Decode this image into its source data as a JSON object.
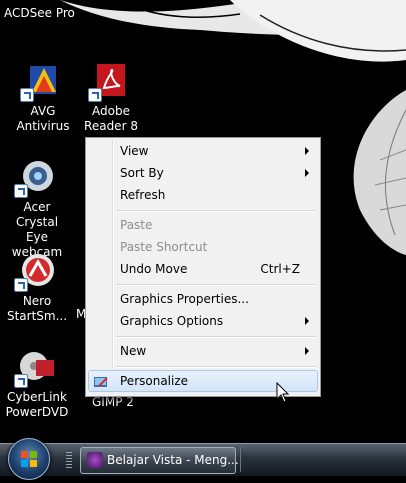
{
  "desktop": {
    "topline": "ACDSee Pro",
    "fragments": {
      "m_letter": "M",
      "gimp": "GIMP 2"
    },
    "icons": [
      {
        "label": "AVG\nAntivirus",
        "icon": "avg-icon"
      },
      {
        "label": "Adobe\nReader 8",
        "icon": "adobe-reader-icon"
      },
      {
        "label": "Acer Crystal\nEye webcam",
        "icon": "webcam-icon"
      },
      {
        "label": "Nero\nStartSm...",
        "icon": "nero-icon"
      },
      {
        "label": "CyberLink\nPowerDVD",
        "icon": "powerdvd-icon"
      }
    ]
  },
  "menu": {
    "items": [
      {
        "label": "View",
        "submenu": true,
        "disabled": false
      },
      {
        "label": "Sort By",
        "submenu": true,
        "disabled": false
      },
      {
        "label": "Refresh",
        "submenu": false,
        "disabled": false
      },
      {
        "label": "Paste",
        "submenu": false,
        "disabled": true
      },
      {
        "label": "Paste Shortcut",
        "submenu": false,
        "disabled": true
      },
      {
        "label": "Undo Move",
        "shortcut": "Ctrl+Z",
        "submenu": false,
        "disabled": false
      },
      {
        "label": "Graphics Properties...",
        "submenu": false,
        "disabled": false
      },
      {
        "label": "Graphics Options",
        "submenu": true,
        "disabled": false
      },
      {
        "label": "New",
        "submenu": true,
        "disabled": false
      },
      {
        "label": "Personalize",
        "submenu": false,
        "disabled": false,
        "highlighted": true,
        "icon": "personalize-icon"
      }
    ]
  },
  "taskbar": {
    "start_icon": "windows-logo-icon",
    "task_button": "Belajar Vista - Meng..."
  },
  "colors": {
    "menu_bg": "#f1f1f1",
    "highlight": "#d3e5f8",
    "taskbar": "#2a323c"
  }
}
